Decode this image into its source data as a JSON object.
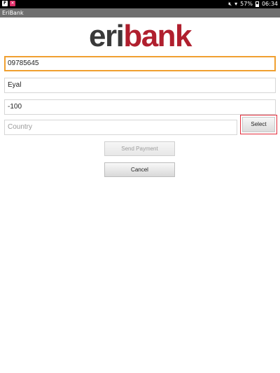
{
  "status_bar": {
    "app_icon_letter": "F",
    "notification_icon": "app-notification-icon",
    "battery": "57%",
    "time": "06:34"
  },
  "app": {
    "title": "EriBank"
  },
  "logo": {
    "part1": "eri",
    "part2": "bank",
    "part1_color": "#3a3a3a",
    "part2_color": "#b01f2e"
  },
  "form": {
    "account_value": "09785645",
    "name_value": "Eyal",
    "amount_value": "-100",
    "country_placeholder": "Country",
    "select_label": "Select",
    "send_label": "Send Payment",
    "cancel_label": "Cancel"
  },
  "colors": {
    "focus": "#f0a030",
    "select_highlight": "#e22b3a",
    "title_bar": "#6f6f6f"
  }
}
